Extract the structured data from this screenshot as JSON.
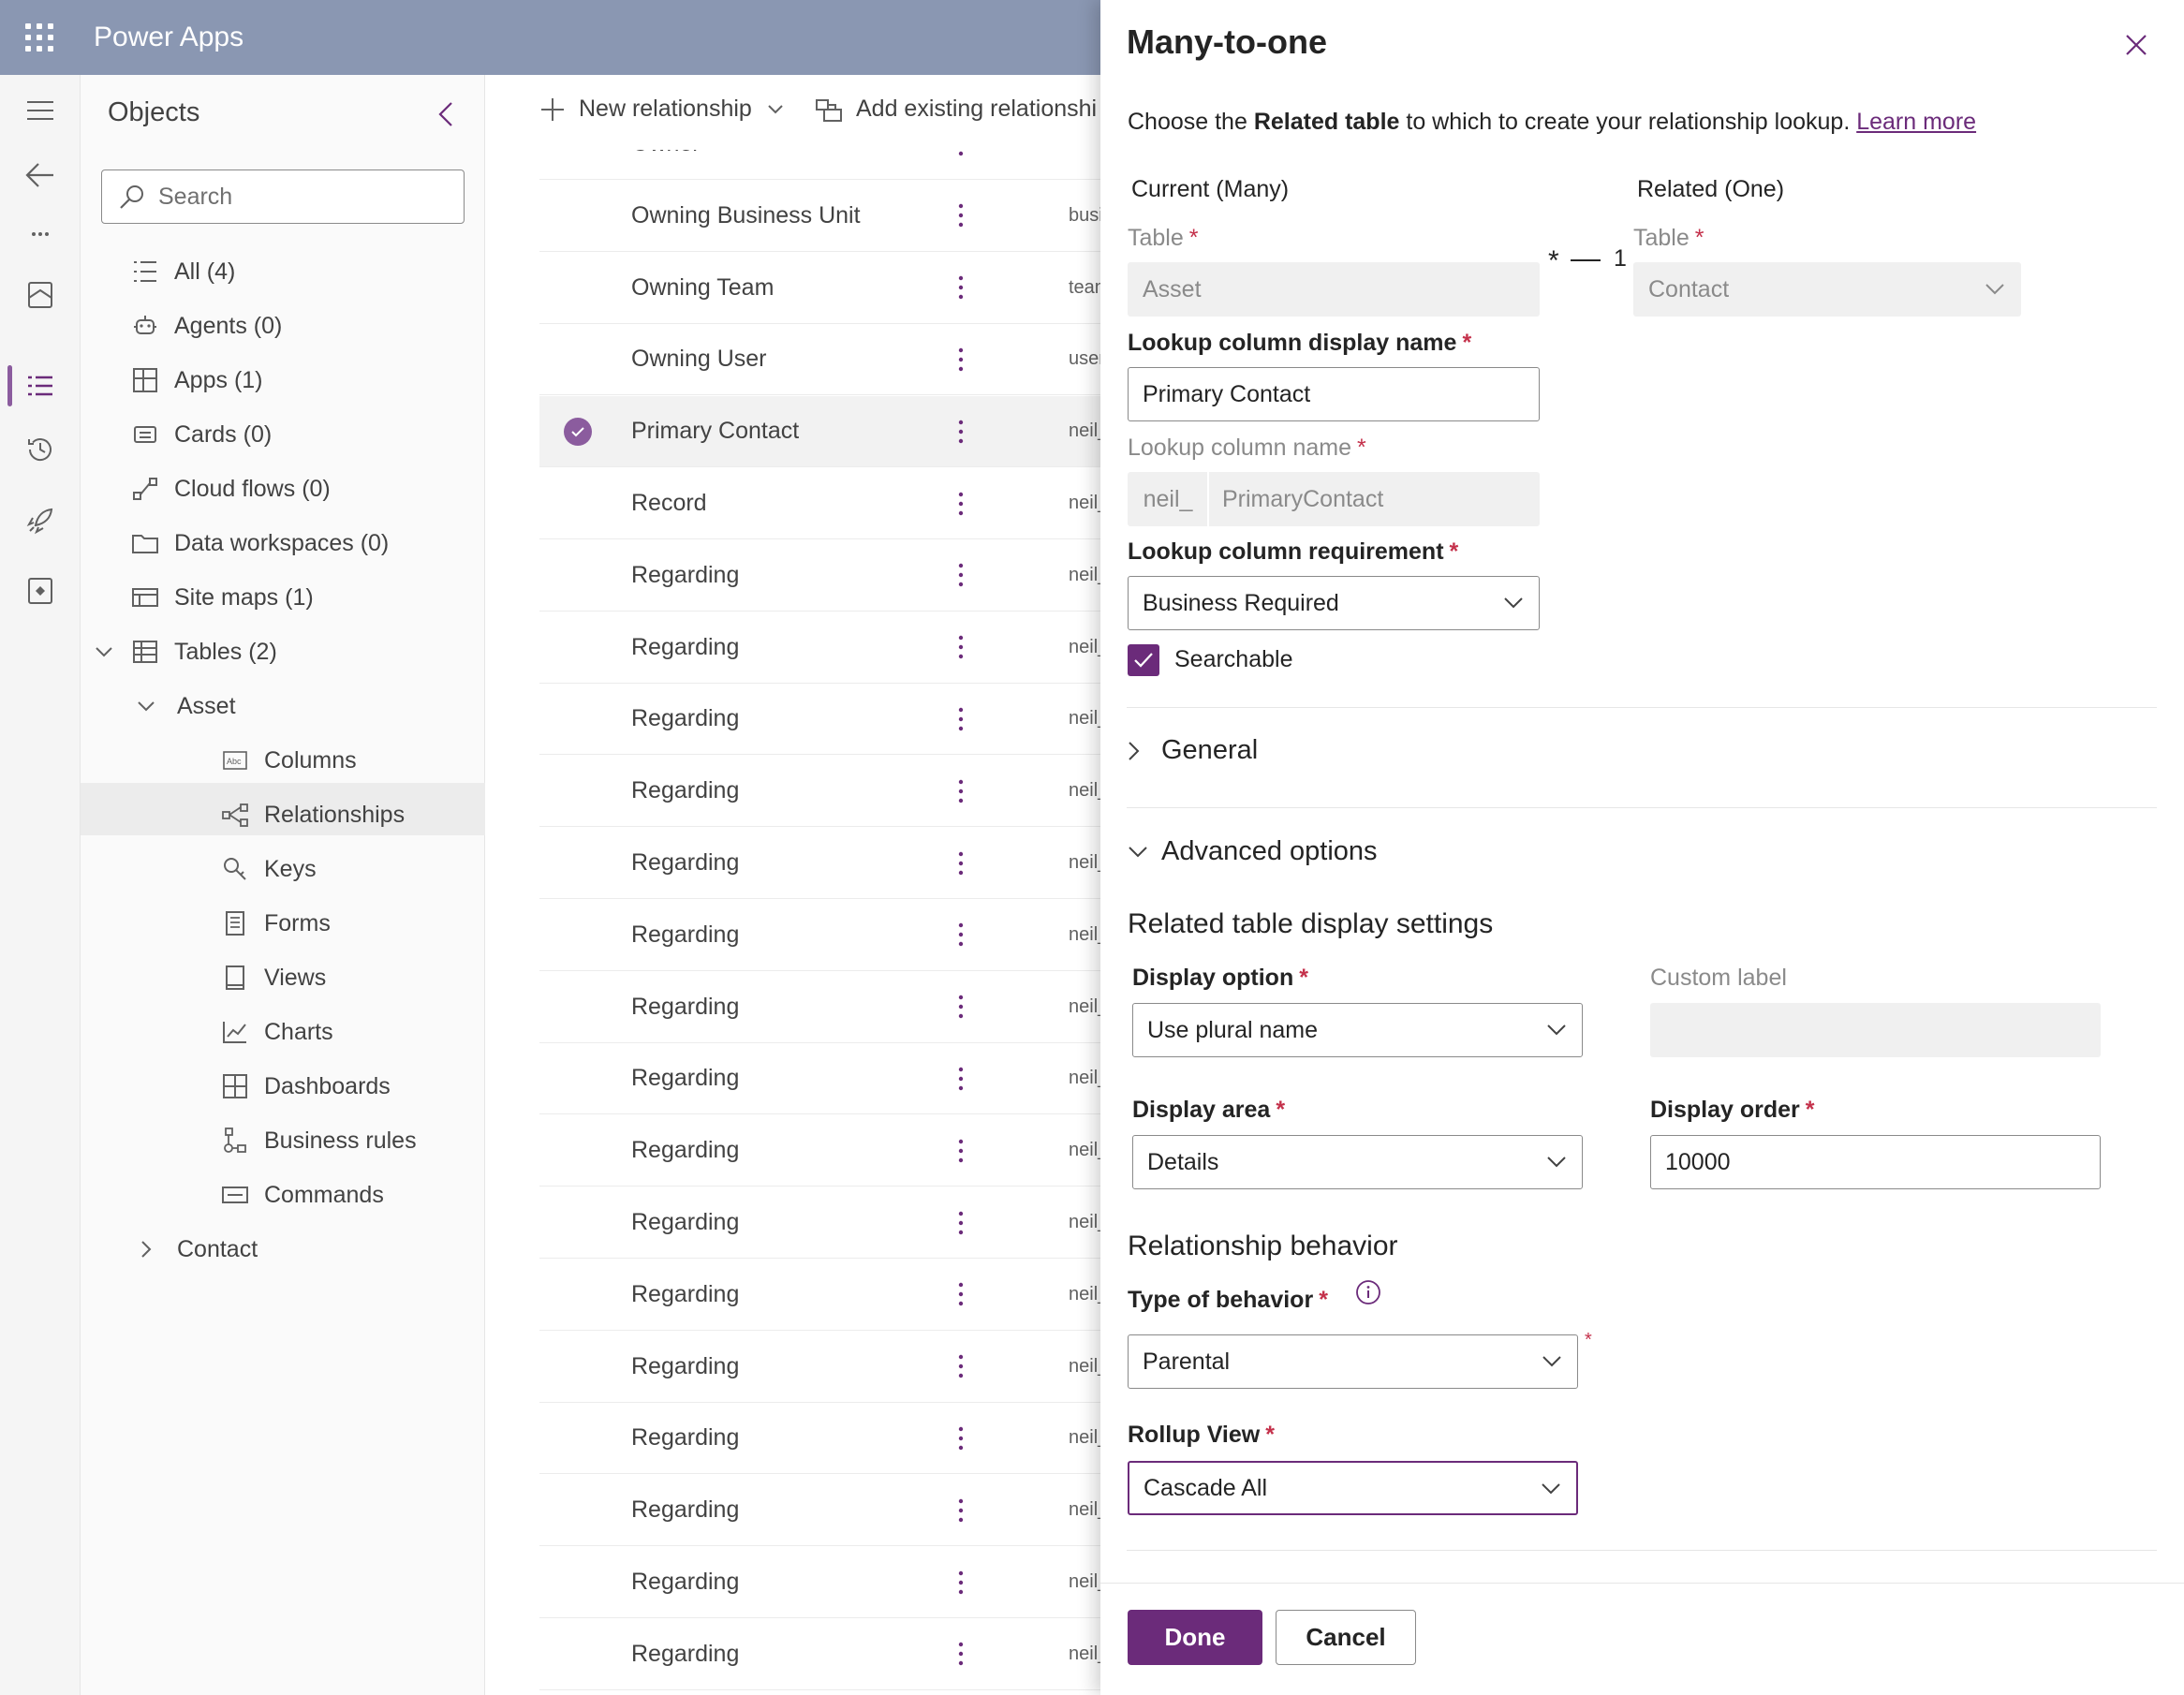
{
  "topbar": {
    "app_title": "Power Apps"
  },
  "objects": {
    "title": "Objects",
    "search": {
      "placeholder": "Search",
      "value": ""
    },
    "items": [
      {
        "label": "All",
        "count": "(4)",
        "icon": "list-icon"
      },
      {
        "label": "Agents",
        "count": "(0)",
        "icon": "bot-icon"
      },
      {
        "label": "Apps",
        "count": "(1)",
        "icon": "apps-icon"
      },
      {
        "label": "Cards",
        "count": "(0)",
        "icon": "card-icon"
      },
      {
        "label": "Cloud flows",
        "count": "(0)",
        "icon": "flow-icon"
      },
      {
        "label": "Data workspaces",
        "count": "(0)",
        "icon": "folder-icon"
      },
      {
        "label": "Site maps",
        "count": "(1)",
        "icon": "sitemap-icon"
      },
      {
        "label": "Tables",
        "count": "(2)",
        "icon": "table-icon"
      }
    ],
    "asset": "Asset",
    "asset_children": [
      {
        "label": "Columns",
        "icon": "columns-icon"
      },
      {
        "label": "Relationships",
        "icon": "relationships-icon"
      },
      {
        "label": "Keys",
        "icon": "key-icon"
      },
      {
        "label": "Forms",
        "icon": "form-icon"
      },
      {
        "label": "Views",
        "icon": "view-icon"
      },
      {
        "label": "Charts",
        "icon": "chart-icon"
      },
      {
        "label": "Dashboards",
        "icon": "dashboard-icon"
      },
      {
        "label": "Business rules",
        "icon": "business-rule-icon"
      },
      {
        "label": "Commands",
        "icon": "command-icon"
      }
    ],
    "contact": "Contact"
  },
  "cmdbar": {
    "new_relationship": "New relationship",
    "add_existing": "Add existing relationshi"
  },
  "list": {
    "rows": [
      {
        "name": "Owner",
        "schema": "owner_ne"
      },
      {
        "name": "Owning Business Unit",
        "schema": "business_"
      },
      {
        "name": "Owning Team",
        "schema": "team_neil"
      },
      {
        "name": "Owning User",
        "schema": "user_neil_"
      },
      {
        "name": "Primary Contact",
        "schema": "neil_asset"
      },
      {
        "name": "Record",
        "schema": "neil_asset"
      },
      {
        "name": "Regarding",
        "schema": "neil_asset"
      },
      {
        "name": "Regarding",
        "schema": "neil_asset"
      },
      {
        "name": "Regarding",
        "schema": "neil_asset"
      },
      {
        "name": "Regarding",
        "schema": "neil_asset"
      },
      {
        "name": "Regarding",
        "schema": "neil_asset"
      },
      {
        "name": "Regarding",
        "schema": "neil_asset"
      },
      {
        "name": "Regarding",
        "schema": "neil_asset"
      },
      {
        "name": "Regarding",
        "schema": "neil_asset"
      },
      {
        "name": "Regarding",
        "schema": "neil_asset"
      },
      {
        "name": "Regarding",
        "schema": "neil_asset"
      },
      {
        "name": "Regarding",
        "schema": "neil_asset"
      },
      {
        "name": "Regarding",
        "schema": "neil_asset"
      },
      {
        "name": "Regarding",
        "schema": "neil_asset"
      },
      {
        "name": "Regarding",
        "schema": "neil_asset"
      },
      {
        "name": "Regarding",
        "schema": "neil_asset"
      },
      {
        "name": "Regarding",
        "schema": "neil_asset"
      }
    ]
  },
  "panel": {
    "title": "Many-to-one",
    "intro_prefix": "Choose the ",
    "intro_bold": "Related table",
    "intro_suffix": " to which to create your relationship lookup. ",
    "learn_more": "Learn more",
    "current_header": "Current (Many)",
    "related_header": "Related (One)",
    "table_label": "Table",
    "current_table": "Asset",
    "related_table": "Contact",
    "many_symbol": "*",
    "one_symbol": "1",
    "lookup_display_label": "Lookup column display name",
    "lookup_display_value": "Primary Contact",
    "lookup_name_label": "Lookup column name",
    "lookup_prefix": "neil_",
    "lookup_name_value": "PrimaryContact",
    "requirement_label": "Lookup column requirement",
    "requirement_value": "Business Required",
    "searchable_label": "Searchable",
    "general_label": "General",
    "advanced_label": "Advanced options",
    "display_settings_header": "Related table display settings",
    "display_option_label": "Display option",
    "display_option_value": "Use plural name",
    "custom_label_label": "Custom label",
    "custom_label_value": "",
    "display_area_label": "Display area",
    "display_area_value": "Details",
    "display_order_label": "Display order",
    "display_order_value": "10000",
    "behavior_header": "Relationship behavior",
    "behavior_type_label": "Type of behavior",
    "behavior_type_value": "Parental",
    "rollup_label": "Rollup View",
    "rollup_value": "Cascade All",
    "required_mark": "*",
    "done": "Done",
    "cancel": "Cancel"
  },
  "colors": {
    "accent": "#6b2b7a",
    "topbar": "#8a97b2",
    "required": "#c4314b"
  }
}
